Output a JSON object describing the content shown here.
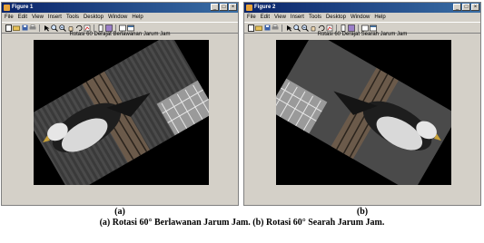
{
  "figure1": {
    "window_title": "Figure 1",
    "menu": [
      "File",
      "Edit",
      "View",
      "Insert",
      "Tools",
      "Desktop",
      "Window",
      "Help"
    ],
    "plot_title": "Rotasi 60 Derajat Berlawanan Jarum Jam"
  },
  "figure2": {
    "window_title": "Figure 2",
    "menu": [
      "File",
      "Edit",
      "View",
      "Insert",
      "Tools",
      "Desktop",
      "Window",
      "Help"
    ],
    "plot_title": "Rotasi 60 Derajat Searah Jarum Jam"
  },
  "window_buttons": {
    "minimize": "_",
    "maximize": "□",
    "close": "×"
  },
  "toolbar_icons": [
    "new-file-icon",
    "open-icon",
    "save-icon",
    "print-icon",
    "arrow-icon",
    "zoom-in-icon",
    "zoom-out-icon",
    "pan-icon",
    "rotate-icon",
    "datacursor-icon",
    "colorbar-icon",
    "legend-icon",
    "plot-tools-icon",
    "hide-tools-icon"
  ],
  "captions": {
    "label_a": "(a)",
    "label_b": "(b)",
    "main": "(a) Rotasi 60° Berlawanan Jarum Jam. (b) Rotasi 60° Searah Jarum Jam."
  }
}
